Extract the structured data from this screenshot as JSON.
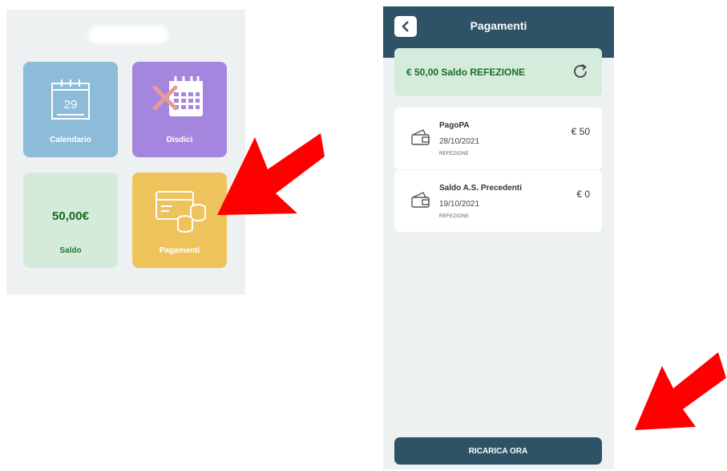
{
  "home": {
    "tiles": [
      {
        "label": "Calendario",
        "calendar_day": "29",
        "color": "#8dbcd8"
      },
      {
        "label": "Disdici",
        "color": "#a586de"
      },
      {
        "label": "Saldo",
        "value": "50,00€",
        "color": "#d4ebdb"
      },
      {
        "label": "Pagamenti",
        "color": "#efc35c"
      }
    ]
  },
  "payments_screen": {
    "title": "Pagamenti",
    "header_color": "#2e5366",
    "balance": "€ 50,00 Saldo REFEZIONE",
    "items": [
      {
        "title": "PagoPA",
        "date": "28/10/2021",
        "type": "REFEZIONE",
        "amount": "€ 50"
      },
      {
        "title": "Saldo A.S. Precedenti",
        "date": "19/10/2021",
        "type": "REFEZIONE",
        "amount": "€ 0"
      }
    ],
    "recharge_label": "RICARICA ORA"
  },
  "annotations": {
    "arrow_color": "#ff0000"
  }
}
